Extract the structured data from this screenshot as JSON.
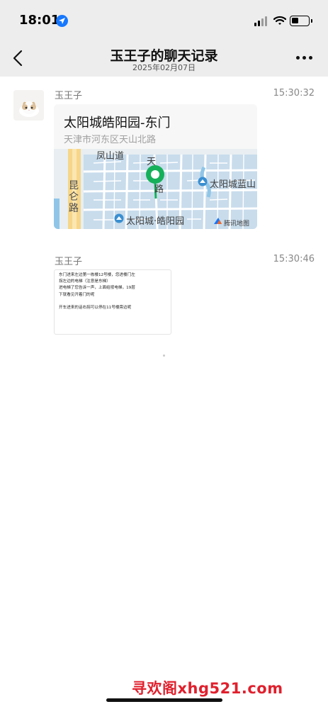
{
  "status_bar": {
    "time": "18:01",
    "location_icon": "location-arrow-icon",
    "signal_icon": "cellular-signal-icon",
    "wifi_icon": "wifi-icon",
    "battery_icon": "battery-icon",
    "battery_level": 0.4
  },
  "nav": {
    "title": "玉王子的聊天记录",
    "date": "2025年02月07日",
    "back_icon": "chevron-left-icon",
    "more_icon": "ellipsis-icon"
  },
  "messages": [
    {
      "sender": "玉王子",
      "time": "15:30:32",
      "type": "location",
      "location": {
        "name": "太阳城皓阳园-东门",
        "address": "天津市河东区天山北路",
        "map_labels": {
          "street_1": "凤山道",
          "street_2_a": "天",
          "street_2_b": "路",
          "road": "昆仑路",
          "poi_1": "太阳城蓝山",
          "poi_2": "太阳城·皓阳园",
          "provider": "腾讯地图"
        }
      }
    },
    {
      "sender": "玉王子",
      "time": "15:30:46",
      "type": "text",
      "lines": [
        "东门进来左边第一栋楼12号楼，您进楼门左",
        "拐左边的电梯（注意是东梯）",
        "进电梯了您告诉一声，上面给按电梯，19层",
        "下就看见开着门的呢",
        "",
        "开车进来的话右拐可以停在11号楼旁边呢"
      ]
    }
  ],
  "watermark": "寻欢阁xhg521.com",
  "colors": {
    "bar_background": "#ededed",
    "accent_blue": "#1677ff",
    "pin_green": "#16b05a",
    "watermark_red": "#e0202d"
  }
}
